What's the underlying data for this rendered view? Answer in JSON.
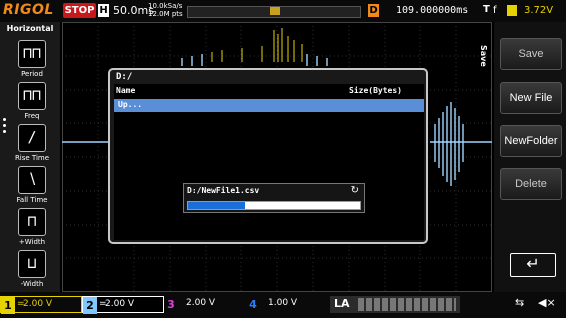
{
  "topbar": {
    "brand": "RIGOL",
    "run_status": "STOP",
    "horizontal_badge": "H",
    "timebase": "50.0ms",
    "sample_rate": "10.0kSa/s",
    "memory_depth": "12.0M pts",
    "delay_badge": "D",
    "delay": "109.000000ms",
    "trigger_badge": "T",
    "trigger_edge": "f",
    "trigger_level": "3.72V"
  },
  "left_menu": {
    "title": "Horizontal",
    "items": [
      {
        "label": "Period",
        "icon": "period-icon",
        "glyph": "⊓⊓"
      },
      {
        "label": "Freq",
        "icon": "freq-icon",
        "glyph": "⊓⊓"
      },
      {
        "label": "Rise Time",
        "icon": "rise-time-icon",
        "glyph": "∕"
      },
      {
        "label": "Fall Time",
        "icon": "fall-time-icon",
        "glyph": "∖"
      },
      {
        "label": "+Width",
        "icon": "positive-width-icon",
        "glyph": "⊓"
      },
      {
        "label": "-Width",
        "icon": "negative-width-icon",
        "glyph": "⊔"
      }
    ]
  },
  "right_menu": {
    "title": "Save",
    "buttons": [
      "Save",
      "New File",
      "NewFolder",
      "Delete"
    ],
    "enter_glyph": "↵"
  },
  "dialog": {
    "path": "D:/",
    "columns": {
      "name": "Name",
      "size": "Size(Bytes)"
    },
    "rows": [
      {
        "name": "Up..."
      }
    ]
  },
  "save_progress": {
    "filename": "D:/NewFile1.csv",
    "refresh_glyph": "↻",
    "progress": 0.33
  },
  "channels": [
    {
      "num": "1",
      "eq": "=",
      "scale": "2.00 V",
      "color": "#e6d200"
    },
    {
      "num": "2",
      "eq": "=",
      "scale": "2.00 V",
      "color": "#7ec8ff"
    },
    {
      "num": "3",
      "scale": "2.00 V",
      "color": "#e040e0"
    },
    {
      "num": "4",
      "scale": "1.00 V",
      "color": "#2b7cff"
    }
  ],
  "la_label": "LA",
  "status_icons": {
    "usb": "⇆",
    "speaker": "◀×"
  }
}
